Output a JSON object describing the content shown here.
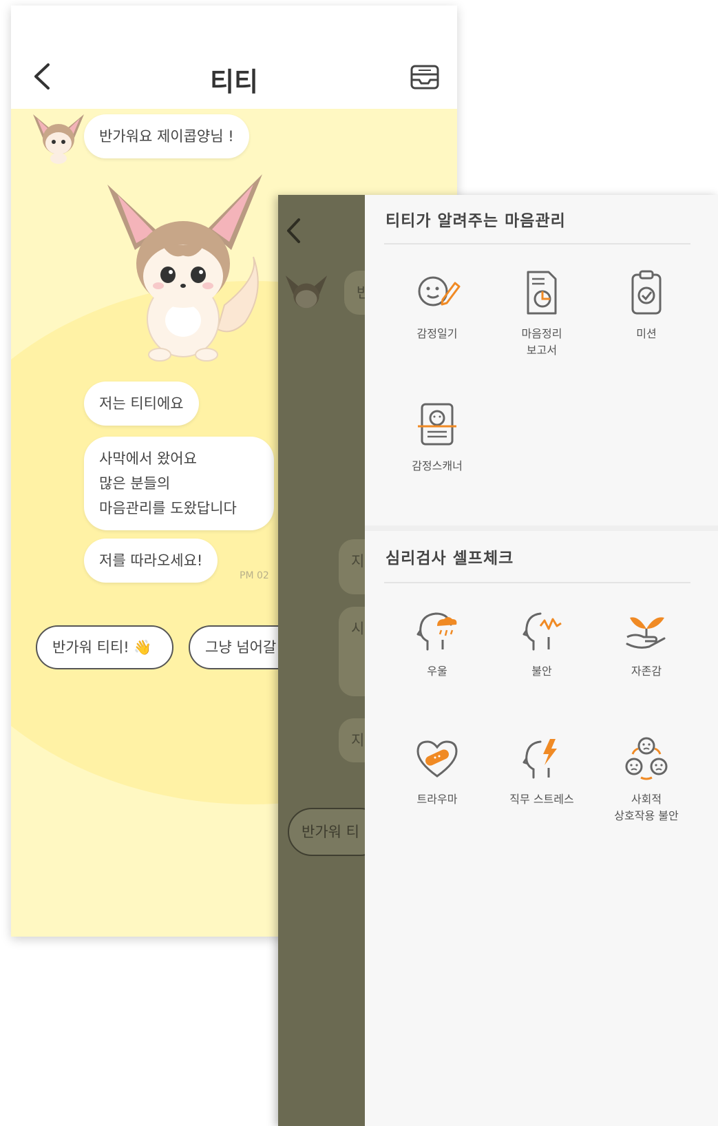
{
  "chat": {
    "title": "티티",
    "messages": [
      "반가워요 제이콥양님 !",
      "저는 티티에요",
      [
        "사막에서 왔어요",
        "많은 분들의",
        "마음관리를 도왔답니다"
      ],
      "저를 따라오세요!"
    ],
    "timestamp": "PM 02",
    "quick_replies": [
      "반가워 티티! 👋",
      "그냥 넘어갈"
    ]
  },
  "overlay": {
    "dim_bubble_fragment": "반",
    "dim_bubble_chars": [
      "지",
      "시",
      "지"
    ],
    "dim_reply": "반가워 티"
  },
  "drawer": {
    "section1": {
      "title": "티티가 알려주는 마음관리",
      "items": [
        {
          "label": [
            "감정일기"
          ],
          "icon": "diary-face-pen-icon"
        },
        {
          "label": [
            "마음정리",
            "보고서"
          ],
          "icon": "report-document-icon"
        },
        {
          "label": [
            "미션"
          ],
          "icon": "clipboard-check-icon"
        },
        {
          "label": [
            "감정스캐너"
          ],
          "icon": "face-scanner-icon"
        }
      ]
    },
    "section2": {
      "title": "심리검사 셀프체크",
      "items": [
        {
          "label": [
            "우울"
          ],
          "icon": "head-cloud-icon"
        },
        {
          "label": [
            "불안"
          ],
          "icon": "head-zigzag-icon"
        },
        {
          "label": [
            "자존감"
          ],
          "icon": "hand-sprout-icon"
        },
        {
          "label": [
            "트라우마"
          ],
          "icon": "bandaged-heart-icon"
        },
        {
          "label": [
            "직무 스트레스"
          ],
          "icon": "head-lightning-icon"
        },
        {
          "label": [
            "사회적",
            "상호작용 불안"
          ],
          "icon": "three-faces-icon"
        }
      ]
    }
  },
  "colors": {
    "chat_background": "#fff8c2",
    "accent_orange": "#f08a24",
    "icon_gray": "#666666",
    "dim_overlay": "#6b6a52",
    "drawer_background": "#f7f7f7"
  }
}
